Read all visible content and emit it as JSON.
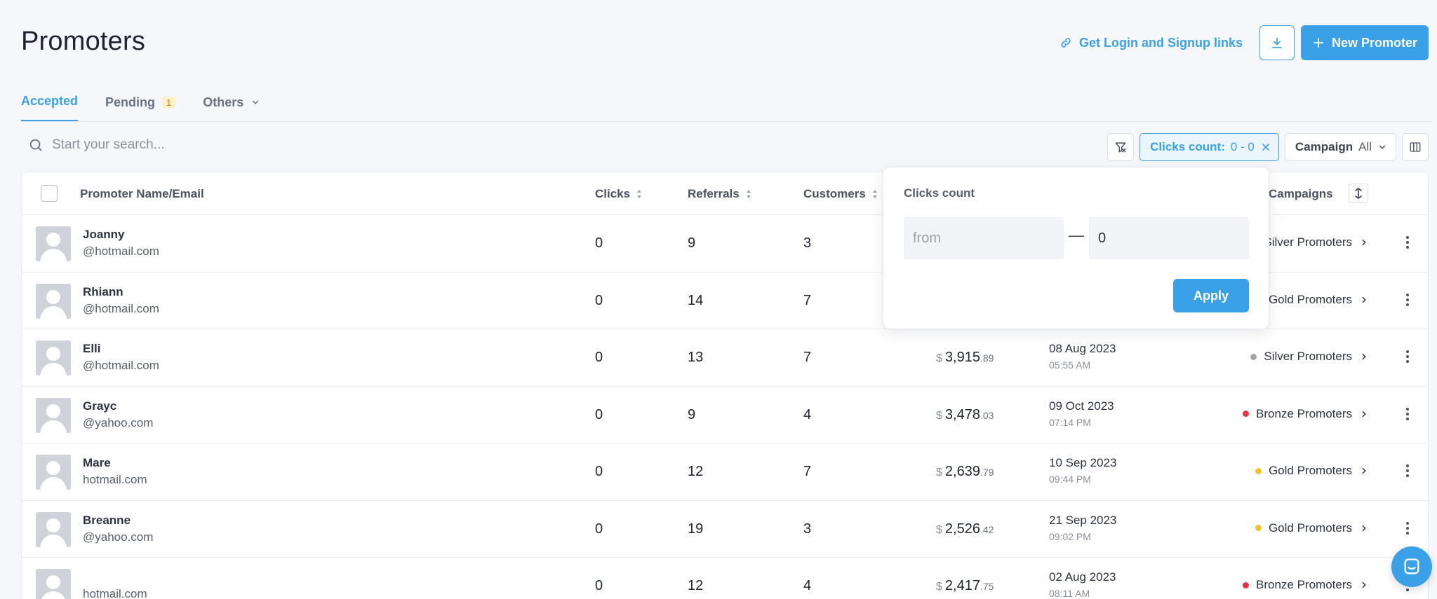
{
  "page": {
    "title": "Promoters"
  },
  "header": {
    "links_label": "Get Login and Signup links",
    "new_promoter_label": "New Promoter"
  },
  "tabs": [
    {
      "label": "Accepted",
      "active": true
    },
    {
      "label": "Pending",
      "badge": "1"
    },
    {
      "label": "Others"
    }
  ],
  "search": {
    "placeholder": "Start your search..."
  },
  "filters": {
    "clicks_label": "Clicks count:",
    "clicks_value": "0 - 0",
    "campaign_label": "Campaign",
    "campaign_value": "All"
  },
  "table": {
    "columns": {
      "name": "Promoter Name/Email",
      "clicks": "Clicks",
      "referrals": "Referrals",
      "customers": "Customers",
      "campaigns": "Campaigns"
    },
    "rows": [
      {
        "name": "Joanny",
        "email": "@hotmail.com",
        "clicks": "0",
        "referrals": "9",
        "customers": "3",
        "campaign": "Silver Promoters",
        "campaign_color": "#a0a4ab"
      },
      {
        "name": "Rhiann",
        "email": "@hotmail.com",
        "clicks": "0",
        "referrals": "14",
        "customers": "7",
        "campaign": "Gold Promoters",
        "campaign_color": "#f2c12e"
      },
      {
        "name": "Elli",
        "email": "@hotmail.com",
        "clicks": "0",
        "referrals": "13",
        "customers": "7",
        "money_cur": "$",
        "money_main": "3,915",
        "money_cents": ".89",
        "date": "08 Aug 2023",
        "time": "05:55 AM",
        "campaign": "Silver Promoters",
        "campaign_color": "#a0a4ab"
      },
      {
        "name": "Grayc",
        "email": "@yahoo.com",
        "clicks": "0",
        "referrals": "9",
        "customers": "4",
        "money_cur": "$",
        "money_main": "3,478",
        "money_cents": ".03",
        "date": "09 Oct 2023",
        "time": "07:14 PM",
        "campaign": "Bronze Promoters",
        "campaign_color": "#e8334a"
      },
      {
        "name": "Mare",
        "email": "hotmail.com",
        "clicks": "0",
        "referrals": "12",
        "customers": "7",
        "money_cur": "$",
        "money_main": "2,639",
        "money_cents": ".79",
        "date": "10 Sep 2023",
        "time": "09:44 PM",
        "campaign": "Gold Promoters",
        "campaign_color": "#f2c12e"
      },
      {
        "name": "Breanne",
        "email": "@yahoo.com",
        "clicks": "0",
        "referrals": "19",
        "customers": "3",
        "money_cur": "$",
        "money_main": "2,526",
        "money_cents": ".42",
        "date": "21 Sep 2023",
        "time": "09:02 PM",
        "campaign": "Gold Promoters",
        "campaign_color": "#f2c12e"
      },
      {
        "name": "",
        "email": "hotmail.com",
        "clicks": "0",
        "referrals": "12",
        "customers": "4",
        "money_cur": "$",
        "money_main": "2,417",
        "money_cents": ".75",
        "date": "02 Aug 2023",
        "time": "08:11 AM",
        "campaign": "Bronze Promoters",
        "campaign_color": "#e8334a"
      }
    ]
  },
  "popover": {
    "title": "Clicks count",
    "from_placeholder": "from",
    "to_value": "0",
    "dash": "—",
    "apply_label": "Apply"
  },
  "colors": {
    "accent": "#3aa0e8",
    "gold": "#f2c12e",
    "silver": "#a0a4ab",
    "bronze": "#e8334a"
  },
  "icons": [
    "link-icon",
    "download-icon",
    "plus-icon",
    "search-icon",
    "filter-off-icon",
    "close-icon",
    "chevron-down-icon",
    "columns-icon",
    "sort-icon",
    "row-height-icon",
    "chevron-right-icon",
    "kebab-icon",
    "avatar-placeholder-icon",
    "chat-icon"
  ]
}
